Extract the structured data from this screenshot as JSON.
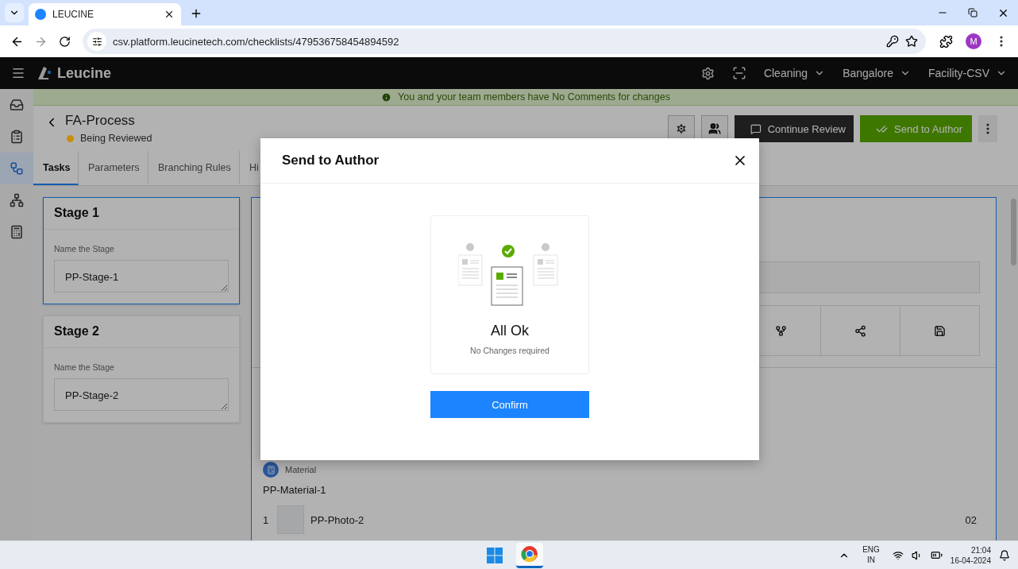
{
  "browser": {
    "tabs": [
      {
        "title": "LEUCINE",
        "selected": true
      }
    ],
    "url": "csv.platform.leucinetech.com/checklists/479536758454894592",
    "profile_initial": "M"
  },
  "header": {
    "brand": "Leucine",
    "menus": [
      "Cleaning",
      "Bangalore",
      "Facility-CSV"
    ]
  },
  "rail": [
    {
      "kind": "inbox",
      "selected": false
    },
    {
      "kind": "checklist",
      "selected": false
    },
    {
      "kind": "flow",
      "selected": true
    },
    {
      "kind": "hierarchy",
      "selected": false
    },
    {
      "kind": "report",
      "selected": false
    }
  ],
  "banner": "You and your team members have No Comments for changes",
  "page": {
    "title": "FA-Process",
    "status": {
      "label": "Being Reviewed",
      "color": "#c7900a"
    },
    "buttons": [
      {
        "kind": "secondary",
        "label": "Continue Review"
      },
      {
        "kind": "primary",
        "label": "Send to Author"
      }
    ]
  },
  "tabs": [
    {
      "label": "Tasks",
      "selected": true
    },
    {
      "label": "Parameters",
      "selected": false
    },
    {
      "label": "Branching Rules",
      "selected": false
    },
    {
      "label": "Hi",
      "selected": false
    }
  ],
  "stages": [
    {
      "title": "Stage 1",
      "field_label": "Name the Stage",
      "value": "PP-Stage-1",
      "selected": true
    },
    {
      "title": "Stage 2",
      "field_label": "Name the Stage",
      "value": "PP-Stage-2",
      "selected": false
    }
  ],
  "task": {
    "parameter_type": "Material",
    "parameter_name": "PP-Material-1",
    "rows": [
      {
        "index": "1",
        "name": "PP-Photo-2",
        "quantity": "02"
      }
    ]
  },
  "modal": {
    "title": "Send to Author",
    "heading": "All Ok",
    "subtext": "No Changes required",
    "confirm": "Confirm"
  },
  "taskbar": {
    "language": [
      "ENG",
      "IN"
    ],
    "time": "21:04",
    "date": "16-04-2024"
  }
}
